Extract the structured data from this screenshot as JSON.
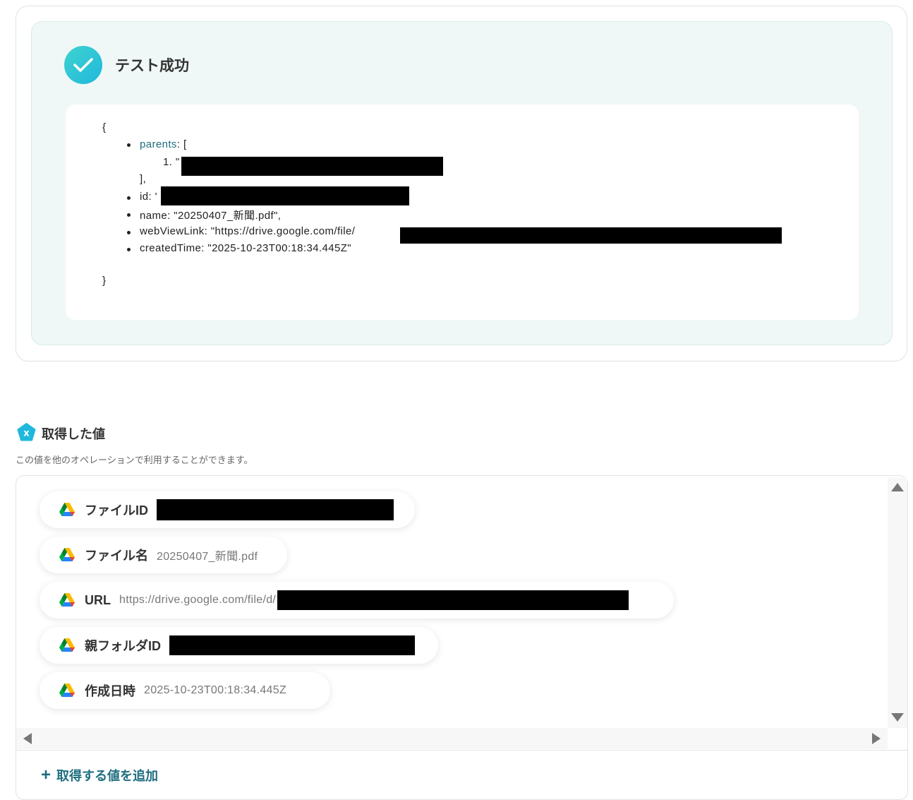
{
  "test_result": {
    "title": "テスト成功",
    "json": {
      "open_brace": "{",
      "close_brace": "}",
      "parents_key": "parents",
      "parents_open": ": [",
      "parents_item_prefix": "1. \"",
      "parents_close": "],",
      "id_line": "id: '",
      "name_line": "name: \"20250407_新聞.pdf\",",
      "webviewlink_line": "webViewLink: \"https://drive.google.com/file/",
      "createdtime_line": "createdTime: \"2025-10-23T00:18:34.445Z\""
    }
  },
  "section": {
    "title": "取得した値",
    "description": "この値を他のオペレーションで利用することができます。"
  },
  "values": [
    {
      "label": "ファイルID",
      "value": ""
    },
    {
      "label": "ファイル名",
      "value": "20250407_新聞.pdf"
    },
    {
      "label": "URL",
      "value": "https://drive.google.com/file/d/"
    },
    {
      "label": "親フォルダID",
      "value": ""
    },
    {
      "label": "作成日時",
      "value": "2025-10-23T00:18:34.445Z"
    }
  ],
  "add_value_label": "取得する値を追加",
  "icons": {
    "success": "check-icon",
    "section": "variable-x-icon",
    "value_source": "google-drive-icon",
    "add": "plus-icon"
  },
  "colors": {
    "accent": "#1f6e80",
    "success_gradient_start": "#3fd3cf",
    "success_gradient_end": "#1fb8dc",
    "panel_bg": "#f0f8f7"
  }
}
